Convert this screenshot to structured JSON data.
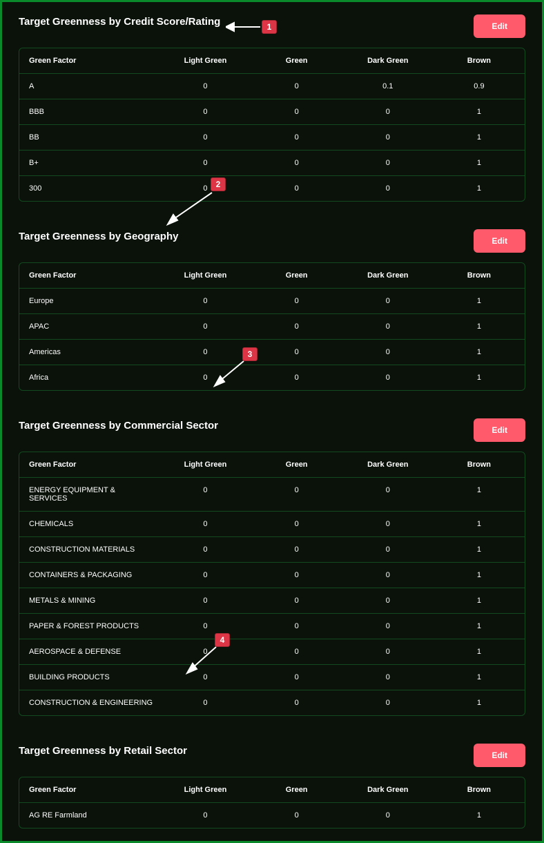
{
  "sections": [
    {
      "title": "Target Greenness by Credit Score/Rating",
      "edit_label": "Edit",
      "columns": [
        "Green Factor",
        "Light Green",
        "Green",
        "Dark Green",
        "Brown"
      ],
      "rows": [
        [
          "A",
          "0",
          "0",
          "0.1",
          "0.9"
        ],
        [
          "BBB",
          "0",
          "0",
          "0",
          "1"
        ],
        [
          "BB",
          "0",
          "0",
          "0",
          "1"
        ],
        [
          "B+",
          "0",
          "0",
          "0",
          "1"
        ],
        [
          "300",
          "0",
          "0",
          "0",
          "1"
        ]
      ]
    },
    {
      "title": "Target Greenness by Geography",
      "edit_label": "Edit",
      "columns": [
        "Green Factor",
        "Light Green",
        "Green",
        "Dark Green",
        "Brown"
      ],
      "rows": [
        [
          "Europe",
          "0",
          "0",
          "0",
          "1"
        ],
        [
          "APAC",
          "0",
          "0",
          "0",
          "1"
        ],
        [
          "Americas",
          "0",
          "0",
          "0",
          "1"
        ],
        [
          "Africa",
          "0",
          "0",
          "0",
          "1"
        ]
      ]
    },
    {
      "title": "Target Greenness by Commercial Sector",
      "edit_label": "Edit",
      "columns": [
        "Green Factor",
        "Light Green",
        "Green",
        "Dark Green",
        "Brown"
      ],
      "rows": [
        [
          "ENERGY EQUIPMENT & SERVICES",
          "0",
          "0",
          "0",
          "1"
        ],
        [
          "CHEMICALS",
          "0",
          "0",
          "0",
          "1"
        ],
        [
          "CONSTRUCTION MATERIALS",
          "0",
          "0",
          "0",
          "1"
        ],
        [
          "CONTAINERS & PACKAGING",
          "0",
          "0",
          "0",
          "1"
        ],
        [
          "METALS & MINING",
          "0",
          "0",
          "0",
          "1"
        ],
        [
          "PAPER & FOREST PRODUCTS",
          "0",
          "0",
          "0",
          "1"
        ],
        [
          "AEROSPACE & DEFENSE",
          "0",
          "0",
          "0",
          "1"
        ],
        [
          "BUILDING PRODUCTS",
          "0",
          "0",
          "0",
          "1"
        ],
        [
          "CONSTRUCTION & ENGINEERING",
          "0",
          "0",
          "0",
          "1"
        ]
      ]
    },
    {
      "title": "Target Greenness by Retail Sector",
      "edit_label": "Edit",
      "columns": [
        "Green Factor",
        "Light Green",
        "Green",
        "Dark Green",
        "Brown"
      ],
      "rows": [
        [
          "AG RE Farmland",
          "0",
          "0",
          "0",
          "1"
        ]
      ]
    }
  ],
  "annotations": {
    "marker1": "1",
    "marker2": "2",
    "marker3": "3",
    "marker4": "4"
  }
}
